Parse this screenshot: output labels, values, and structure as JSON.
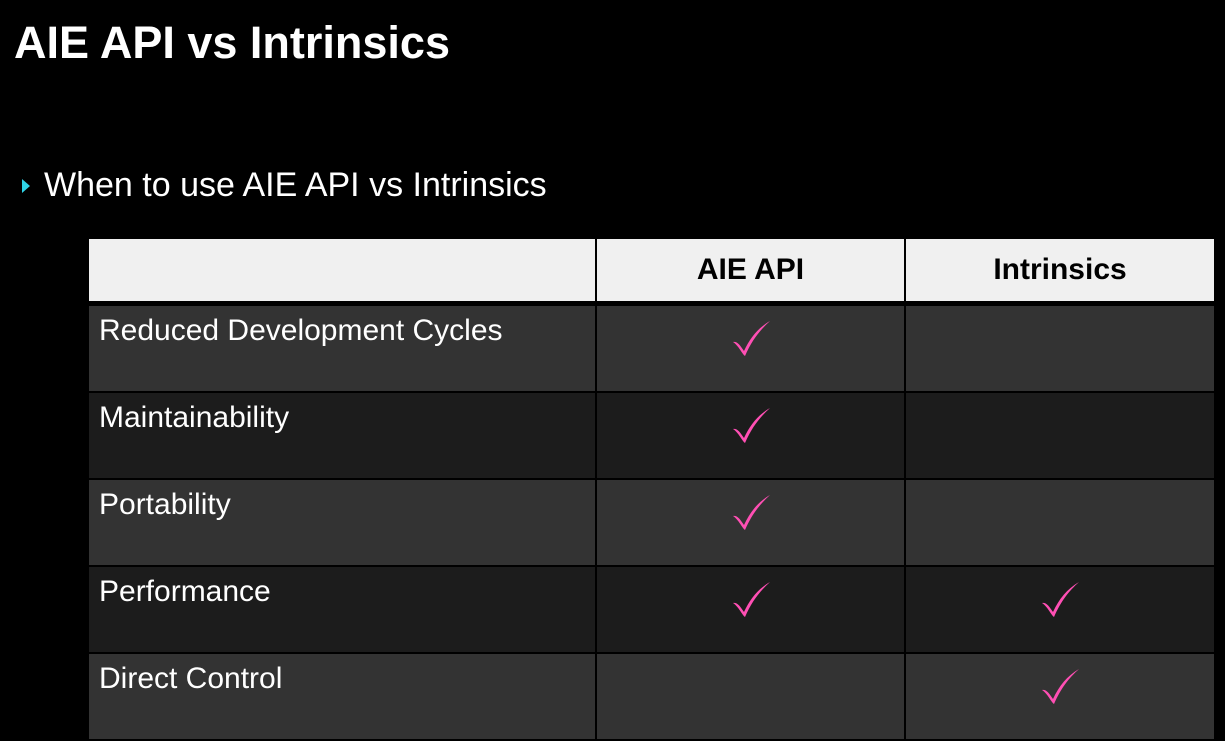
{
  "slide": {
    "title": "AIE API vs Intrinsics",
    "bullet": "When to use AIE API vs Intrinsics",
    "bullet_icon": "triangle-right-icon",
    "accent_color": "#2fd3e6",
    "check_color": "#ff4fb4"
  },
  "table": {
    "headers": [
      "",
      "AIE API",
      "Intrinsics"
    ],
    "rows": [
      {
        "label": "Reduced Development Cycles",
        "aie_api": true,
        "intrinsics": false
      },
      {
        "label": "Maintainability",
        "aie_api": true,
        "intrinsics": false
      },
      {
        "label": "Portability",
        "aie_api": true,
        "intrinsics": false
      },
      {
        "label": "Performance",
        "aie_api": true,
        "intrinsics": true
      },
      {
        "label": "Direct Control",
        "aie_api": false,
        "intrinsics": true
      }
    ]
  }
}
